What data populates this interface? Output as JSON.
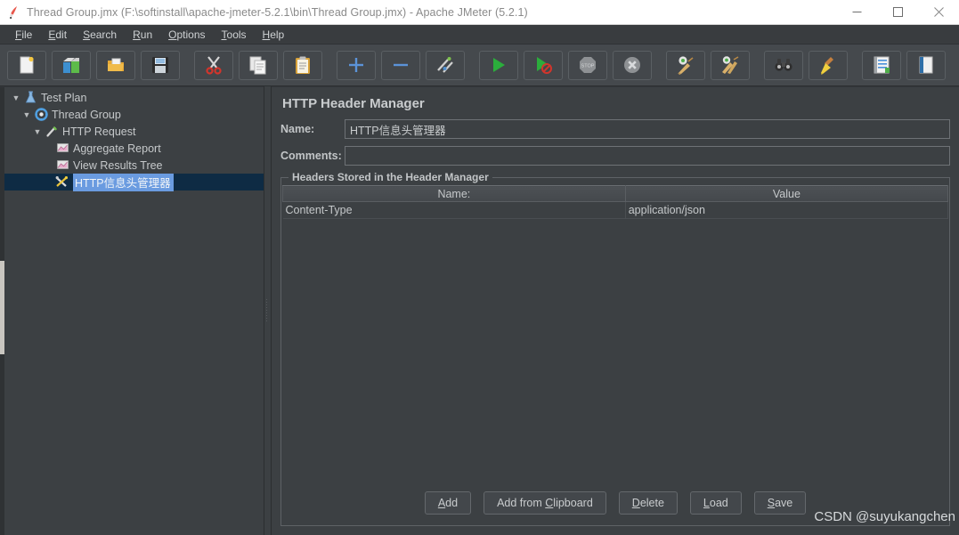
{
  "window": {
    "title": "Thread Group.jmx (F:\\softinstall\\apache-jmeter-5.2.1\\bin\\Thread Group.jmx) - Apache JMeter (5.2.1)",
    "app_icon": "jmeter-feather-icon",
    "minimize_label": "Minimize",
    "maximize_label": "Maximize",
    "close_label": "Close"
  },
  "menubar": {
    "items": [
      {
        "label": "File",
        "mnemonic": "F"
      },
      {
        "label": "Edit",
        "mnemonic": "E"
      },
      {
        "label": "Search",
        "mnemonic": "S"
      },
      {
        "label": "Run",
        "mnemonic": "R"
      },
      {
        "label": "Options",
        "mnemonic": "O"
      },
      {
        "label": "Tools",
        "mnemonic": "T"
      },
      {
        "label": "Help",
        "mnemonic": "H"
      }
    ]
  },
  "toolbar": {
    "buttons": [
      {
        "name": "new-test-plan-button",
        "icon": "new-document-icon",
        "tooltip": "New"
      },
      {
        "name": "templates-button",
        "icon": "templates-icon",
        "tooltip": "Templates"
      },
      {
        "name": "open-button",
        "icon": "open-folder-icon",
        "tooltip": "Open"
      },
      {
        "name": "save-button",
        "icon": "floppy-disk-icon",
        "tooltip": "Save Test Plan"
      },
      {
        "name": "cut-button",
        "icon": "scissors-icon",
        "tooltip": "Cut"
      },
      {
        "name": "copy-button",
        "icon": "copy-pages-icon",
        "tooltip": "Copy"
      },
      {
        "name": "paste-button",
        "icon": "clipboard-icon",
        "tooltip": "Paste"
      },
      {
        "name": "expand-all-button",
        "icon": "plus-icon",
        "tooltip": "Expand All"
      },
      {
        "name": "collapse-all-button",
        "icon": "minus-icon",
        "tooltip": "Collapse All"
      },
      {
        "name": "toggle-button",
        "icon": "toggle-pencil-icon",
        "tooltip": "Toggle"
      },
      {
        "name": "start-button",
        "icon": "play-green-icon",
        "tooltip": "Start"
      },
      {
        "name": "start-no-pauses-button",
        "icon": "play-no-pauses-icon",
        "tooltip": "Start no pauses"
      },
      {
        "name": "stop-button",
        "icon": "stop-sign-icon",
        "tooltip": "Stop"
      },
      {
        "name": "shutdown-button",
        "icon": "shutdown-x-icon",
        "tooltip": "Shutdown"
      },
      {
        "name": "clear-button",
        "icon": "gear-broom-icon",
        "tooltip": "Clear"
      },
      {
        "name": "clear-all-button",
        "icon": "gear-brooms-icon",
        "tooltip": "Clear All"
      },
      {
        "name": "search-button",
        "icon": "binoculars-icon",
        "tooltip": "Search"
      },
      {
        "name": "reset-search-button",
        "icon": "broom-yellow-icon",
        "tooltip": "Reset Search"
      },
      {
        "name": "function-helper-button",
        "icon": "notepad-list-icon",
        "tooltip": "Function Helper Dialog"
      },
      {
        "name": "help-button",
        "icon": "help-book-icon",
        "tooltip": "Help"
      }
    ]
  },
  "tree": {
    "nodes": [
      {
        "label": "Test Plan",
        "indent": 0,
        "twisty": "▼",
        "icon": "test-plan-icon",
        "selected": false
      },
      {
        "label": "Thread Group",
        "indent": 1,
        "twisty": "▼",
        "icon": "thread-group-icon",
        "selected": false
      },
      {
        "label": "HTTP Request",
        "indent": 2,
        "twisty": "▼",
        "icon": "http-request-icon",
        "selected": false
      },
      {
        "label": "Aggregate Report",
        "indent": 3,
        "twisty": "",
        "icon": "report-chart-icon",
        "selected": false
      },
      {
        "label": "View Results Tree",
        "indent": 3,
        "twisty": "",
        "icon": "report-chart-icon",
        "selected": false
      },
      {
        "label": "HTTP信息头管理器",
        "indent": 3,
        "twisty": "",
        "icon": "header-manager-icon",
        "selected": true
      }
    ]
  },
  "splitter": {
    "grip": "splitter-grip"
  },
  "main": {
    "panel_title": "HTTP Header Manager",
    "name_label": "Name:",
    "name_value": "HTTP信息头管理器",
    "comments_label": "Comments:",
    "comments_value": "",
    "group_title": "Headers Stored in the Header Manager",
    "table": {
      "columns": [
        "Name:",
        "Value"
      ],
      "rows": [
        [
          "Content-Type",
          "application/json"
        ]
      ]
    },
    "buttons": [
      {
        "label": "Add",
        "mnemonic": "A",
        "name": "add-button"
      },
      {
        "label": "Add from Clipboard",
        "mnemonic": "C",
        "name": "add-from-clipboard-button"
      },
      {
        "label": "Delete",
        "mnemonic": "D",
        "name": "delete-button"
      },
      {
        "label": "Load",
        "mnemonic": "L",
        "name": "load-button"
      },
      {
        "label": "Save",
        "mnemonic": "S",
        "name": "save-headers-button"
      }
    ]
  },
  "watermark": {
    "text": "CSDN @suyukangchen"
  },
  "colors": {
    "window_bg": "#3c4043",
    "titlebar_bg": "#ffffff",
    "toolbar_bg": "#45494d",
    "selection_row": "#0e2b44",
    "selection_text_bg": "#6a9be0",
    "text": "#c6c9cb",
    "border": "#5e6266",
    "scroll_thumb": "#c9c6c0"
  }
}
